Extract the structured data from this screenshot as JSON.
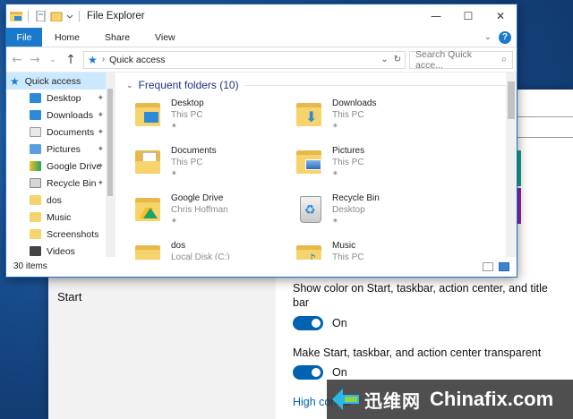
{
  "explorer": {
    "title": "File Explorer",
    "controls": {
      "minimize": "—",
      "maximize": "☐",
      "close": "✕"
    },
    "ribbon": {
      "file": "File",
      "tabs": [
        "Home",
        "Share",
        "View"
      ],
      "expand": "⌄",
      "help": "?"
    },
    "nav": {
      "back": "←",
      "forward": "→",
      "recent": "⌄",
      "up": "↑"
    },
    "address": {
      "location": "Quick access",
      "dropdown": "⌄",
      "refresh": "↻"
    },
    "search": {
      "placeholder": "Search Quick acce...",
      "icon": "⌕"
    },
    "navpane": {
      "items": [
        {
          "label": "Quick access",
          "icon": "star-icon",
          "pinned": false
        },
        {
          "label": "Desktop",
          "icon": "desktop-folder-icon",
          "pinned": true
        },
        {
          "label": "Downloads",
          "icon": "downloads-folder-icon",
          "pinned": true
        },
        {
          "label": "Documents",
          "icon": "documents-folder-icon",
          "pinned": true
        },
        {
          "label": "Pictures",
          "icon": "pictures-folder-icon",
          "pinned": true
        },
        {
          "label": "Google Drive",
          "icon": "google-drive-icon",
          "pinned": true
        },
        {
          "label": "Recycle Bin",
          "icon": "recycle-bin-icon",
          "pinned": true
        },
        {
          "label": "dos",
          "icon": "folder-icon",
          "pinned": false
        },
        {
          "label": "Music",
          "icon": "music-folder-icon",
          "pinned": false
        },
        {
          "label": "Screenshots",
          "icon": "folder-icon",
          "pinned": false
        },
        {
          "label": "Videos",
          "icon": "videos-folder-icon",
          "pinned": false
        }
      ],
      "pin_glyph": "📌"
    },
    "group": {
      "title": "Frequent folders (10)",
      "chevron": "⌄"
    },
    "tiles": [
      {
        "name": "Desktop",
        "location": "This PC",
        "pin": "✷"
      },
      {
        "name": "Downloads",
        "location": "This PC",
        "pin": "✷"
      },
      {
        "name": "Documents",
        "location": "This PC",
        "pin": "✷"
      },
      {
        "name": "Pictures",
        "location": "This PC",
        "pin": "✷"
      },
      {
        "name": "Google Drive",
        "location": "Chris Hoffman",
        "pin": "✷"
      },
      {
        "name": "Recycle Bin",
        "location": "Desktop",
        "pin": "✷"
      },
      {
        "name": "dos",
        "location": "Local Disk (C:)"
      },
      {
        "name": "Music",
        "location": "This PC"
      }
    ],
    "status": {
      "count": "30 items"
    }
  },
  "settings": {
    "left_label": "Start",
    "option1": "Show color on Start, taskbar, action center, and title bar",
    "toggle1": "On",
    "option2": "Make Start, taskbar, and action center transparent",
    "toggle2": "On",
    "link": "High contra"
  },
  "watermark": {
    "cn": "迅维网",
    "en": "Chinafix.com"
  }
}
